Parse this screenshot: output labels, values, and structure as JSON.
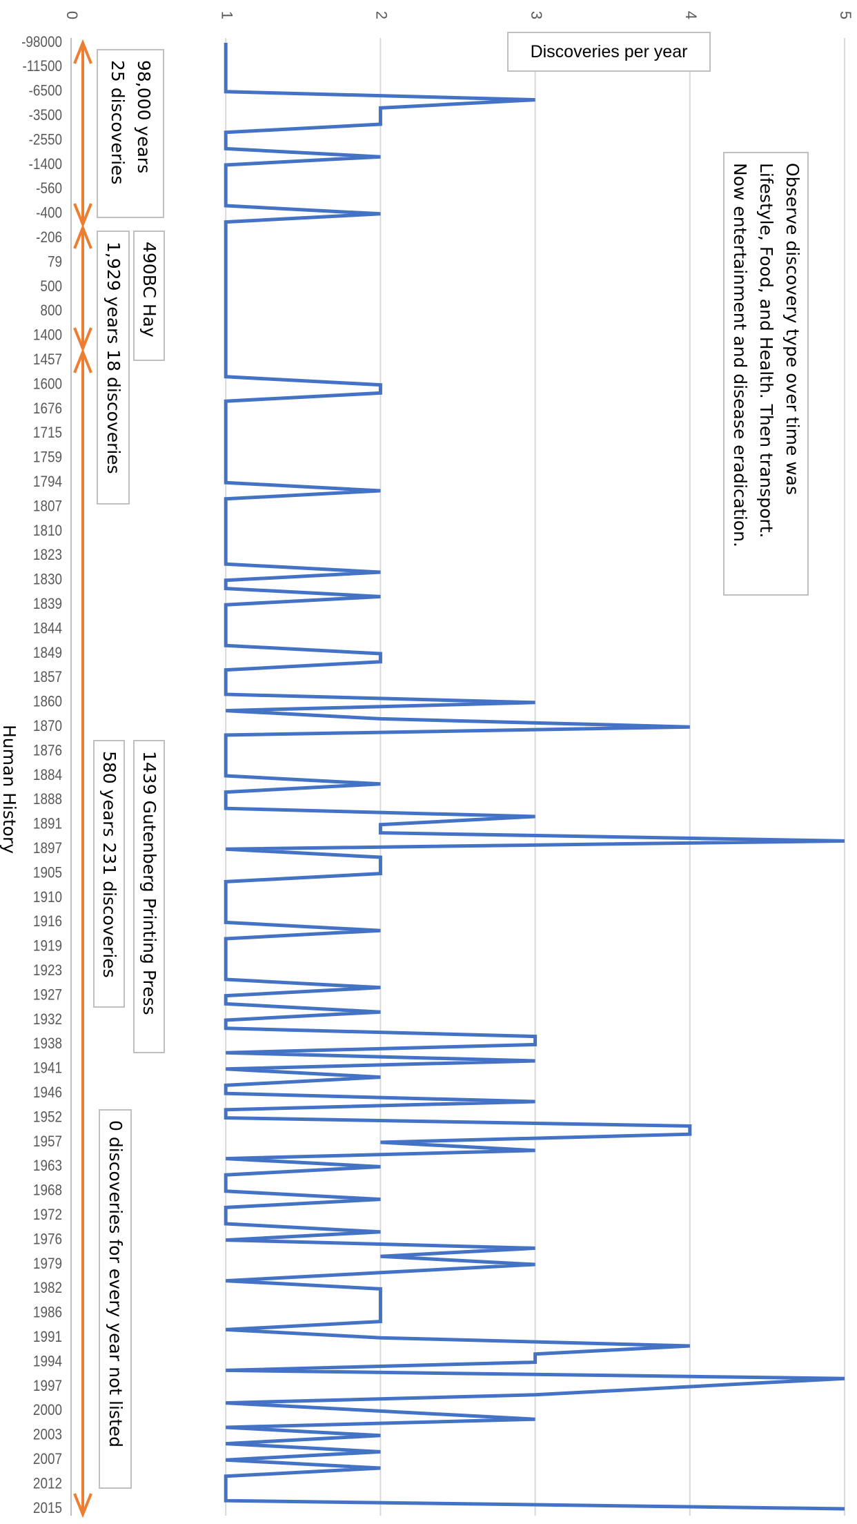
{
  "chart_data": {
    "type": "line",
    "orientation": "rotated-90-clockwise",
    "title": "Discoveries per year",
    "xlabel": "Human History",
    "ylabel": "",
    "ylim": [
      0,
      5
    ],
    "yticks": [
      "0",
      "1",
      "2",
      "3",
      "4",
      "5"
    ],
    "grid": true,
    "labeled_every": 3,
    "categories": [
      "-98000",
      "",
      "",
      "-11500",
      "",
      "",
      "-6500",
      "",
      "",
      "-3500",
      "",
      "",
      "-2550",
      "",
      "",
      "-1400",
      "",
      "",
      "-560",
      "",
      "",
      "-400",
      "",
      "",
      "-206",
      "",
      "",
      "79",
      "",
      "",
      "500",
      "",
      "",
      "800",
      "",
      "",
      "1400",
      "",
      "",
      "1457",
      "",
      "",
      "1600",
      "",
      "",
      "1676",
      "",
      "",
      "1715",
      "",
      "",
      "1759",
      "",
      "",
      "1794",
      "",
      "",
      "1807",
      "",
      "",
      "1810",
      "",
      "",
      "1823",
      "",
      "",
      "1830",
      "",
      "",
      "1839",
      "",
      "",
      "1844",
      "",
      "",
      "1849",
      "",
      "",
      "1857",
      "",
      "",
      "1860",
      "",
      "",
      "1870",
      "",
      "",
      "1876",
      "",
      "",
      "1884",
      "",
      "",
      "1888",
      "",
      "",
      "1891",
      "",
      "",
      "1897",
      "",
      "",
      "1905",
      "",
      "",
      "1910",
      "",
      "",
      "1916",
      "",
      "",
      "1919",
      "",
      "",
      "1923",
      "",
      "",
      "1927",
      "",
      "",
      "1932",
      "",
      "",
      "1938",
      "",
      "",
      "1941",
      "",
      "",
      "1946",
      "",
      "",
      "1952",
      "",
      "",
      "1957",
      "",
      "",
      "1963",
      "",
      "",
      "1968",
      "",
      "",
      "1972",
      "",
      "",
      "1976",
      "",
      "",
      "1979",
      "",
      "",
      "1982",
      "",
      "",
      "1986",
      "",
      "",
      "1991",
      "",
      "",
      "1994",
      "",
      "",
      "1997",
      "",
      "",
      "2000",
      "",
      "",
      "2003",
      "",
      "",
      "2007",
      "",
      "",
      "2012",
      "",
      "",
      "2015"
    ],
    "series": [
      {
        "color": "#4472c4",
        "values": [
          1,
          1,
          1,
          1,
          1,
          1,
          1,
          3,
          2,
          2,
          2,
          1,
          1,
          1,
          2,
          1,
          1,
          1,
          1,
          1,
          1,
          2,
          1,
          1,
          1,
          1,
          1,
          1,
          1,
          1,
          1,
          1,
          1,
          1,
          1,
          1,
          1,
          1,
          1,
          1,
          1,
          1,
          2,
          2,
          1,
          1,
          1,
          1,
          1,
          1,
          1,
          1,
          1,
          1,
          1,
          2,
          1,
          1,
          1,
          1,
          1,
          1,
          1,
          1,
          1,
          2,
          1,
          1,
          2,
          1,
          1,
          1,
          1,
          1,
          1,
          2,
          2,
          1,
          1,
          1,
          1,
          3,
          1,
          2,
          4,
          1,
          1,
          1,
          1,
          1,
          1,
          2,
          1,
          1,
          1,
          3,
          2,
          2,
          5,
          1,
          2,
          2,
          2,
          1,
          1,
          1,
          1,
          1,
          1,
          2,
          1,
          1,
          1,
          1,
          1,
          1,
          2,
          1,
          1,
          2,
          1,
          1,
          3,
          3,
          1,
          3,
          1,
          2,
          1,
          1,
          3,
          1,
          1,
          4,
          4,
          2,
          3,
          1,
          2,
          1,
          1,
          1,
          2,
          1,
          1,
          1,
          2,
          1,
          3,
          2,
          3,
          2,
          1,
          2,
          2,
          2,
          2,
          2,
          1,
          2,
          4,
          3,
          3,
          1,
          5,
          4,
          3,
          1,
          2,
          3,
          1,
          2,
          1,
          2,
          1,
          2,
          1,
          1,
          1,
          1,
          5
        ]
      }
    ],
    "era_arrow_color": "#ed7d31",
    "annotations": {
      "era1": "98,000 years\n25 discoveries",
      "era2": "1,929 years 18 discoveries",
      "hay": "490BC Hay",
      "era3": "580 years 231 discoveries",
      "gutenberg": "1439 Gutenberg Printing Press",
      "note_unlisted": "0 discoveries for every year not listed",
      "observe": "Observe discovery type over time was\nLifestyle, Food, and Health. Then transport.\nNow entertainment and disease eradication."
    }
  }
}
